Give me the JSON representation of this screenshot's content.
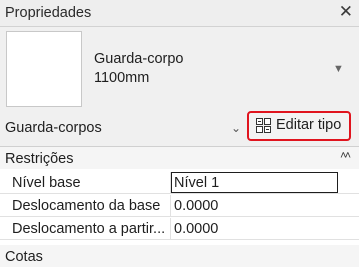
{
  "panel": {
    "title": "Propriedades",
    "close_glyph": "✕"
  },
  "type_selector": {
    "name_line1": "Guarda-corpo",
    "name_line2": "1100mm",
    "dropdown_icon": "chevron-down-icon"
  },
  "family": {
    "label": "Guarda-corpos",
    "dropdown_icon": "chevron-down-icon"
  },
  "edit_type": {
    "label": "Editar tipo",
    "icon": "edit-type-icon",
    "highlight_color": "#e0141e"
  },
  "groups": {
    "constraints": {
      "label": "Restrições",
      "collapse_glyph": "˄˄",
      "rows": [
        {
          "name": "Nível base",
          "value": "Nível 1"
        },
        {
          "name": "Deslocamento da base",
          "value": "0.0000"
        },
        {
          "name": "Deslocamento a partir...",
          "value": "0.0000"
        }
      ]
    },
    "dimensions": {
      "label": "Cotas"
    }
  }
}
